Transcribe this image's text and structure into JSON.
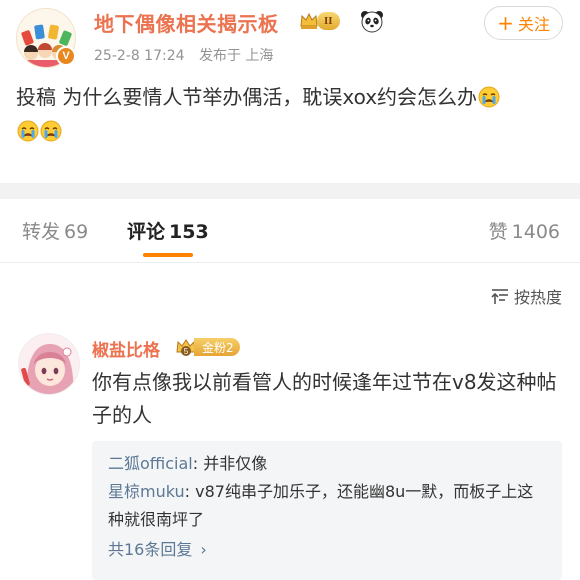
{
  "post": {
    "author": "地下偶像相关揭示板",
    "member_level": "II",
    "time": "25-2-8 17:24",
    "location": "发布于 上海",
    "follow_label": "关注",
    "text": "投稿 为什么要情人节举办偶活，耽误xox约会怎么办",
    "avatar_badge": "V",
    "emoji": "crying-face"
  },
  "tabs": [
    {
      "label": "转发",
      "count": "69"
    },
    {
      "label": "评论",
      "count": "153"
    },
    {
      "label": "赞",
      "count": "1406"
    }
  ],
  "sort": {
    "label": "按热度"
  },
  "comment": {
    "user": "椒盐比格",
    "fan_level_icon_text": "5",
    "fan_badge": "金粉2",
    "text": "你有点像我以前看管人的时候逢年过节在v8发这种帖子的人",
    "replies": [
      {
        "user": "二狐official",
        "text": ": 并非仅像"
      },
      {
        "user": "星椋muku",
        "text": ": v87纯串子加乐子，还能幽8u一默，而板子上这种就很南坪了"
      }
    ],
    "more_replies": "共16条回复"
  },
  "colors": {
    "accent": "#ff8200",
    "username": "#eb7350",
    "link": "#5d7895",
    "divider_band": "#f2f2f2"
  }
}
